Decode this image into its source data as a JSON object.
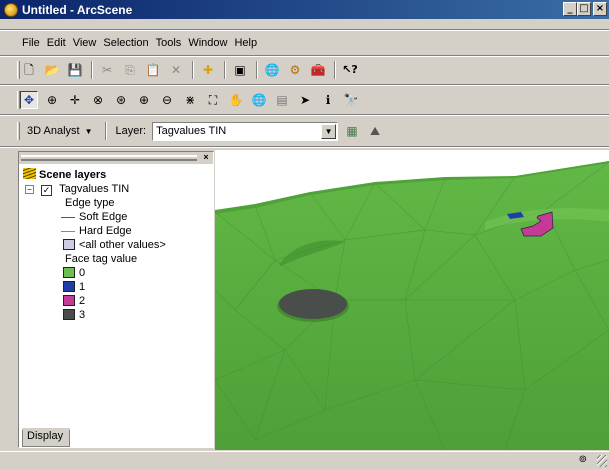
{
  "window": {
    "title": "Untitled - ArcScene",
    "min_glyph": "_",
    "max_glyph": "□",
    "close_glyph": "×"
  },
  "menu": [
    "File",
    "Edit",
    "View",
    "Selection",
    "Tools",
    "Window",
    "Help"
  ],
  "standard_toolbar": [
    {
      "icon": "new-icon",
      "glyph": "🗋"
    },
    {
      "icon": "open-icon",
      "glyph": "📂"
    },
    {
      "icon": "save-icon",
      "glyph": "💾"
    },
    {
      "icon": "cut-icon",
      "glyph": "✂"
    },
    {
      "icon": "copy-icon",
      "glyph": "⎘"
    },
    {
      "icon": "paste-icon",
      "glyph": "📋"
    },
    {
      "icon": "delete-icon",
      "glyph": "✕"
    },
    {
      "icon": "add-data-icon",
      "glyph": "✚"
    },
    {
      "icon": "scene-properties-icon",
      "glyph": "▣"
    },
    {
      "icon": "arctoolbox-icon",
      "glyph": "🌐"
    },
    {
      "icon": "model-builder-icon",
      "glyph": "⚙"
    },
    {
      "icon": "toolbox-icon",
      "glyph": "🧰"
    },
    {
      "icon": "whats-this-icon",
      "glyph": "↖?"
    }
  ],
  "navigation_toolbar": [
    {
      "icon": "navigate-icon",
      "glyph": "✥"
    },
    {
      "icon": "zoom-in-out-icon",
      "glyph": "⊕"
    },
    {
      "icon": "pan-icon",
      "glyph": "✛"
    },
    {
      "icon": "center-on-target-icon",
      "glyph": "⊗"
    },
    {
      "icon": "zoom-to-target-icon",
      "glyph": "⊛"
    },
    {
      "icon": "zoom-in-icon",
      "glyph": "⊕"
    },
    {
      "icon": "zoom-out-icon",
      "glyph": "⊖"
    },
    {
      "icon": "narrow-fov-icon",
      "glyph": "⋇"
    },
    {
      "icon": "full-extent-icon",
      "glyph": "⛶"
    },
    {
      "icon": "hand-icon",
      "glyph": "✋"
    },
    {
      "icon": "globe-icon",
      "glyph": "🌐"
    },
    {
      "icon": "layers-icon",
      "glyph": "▤"
    },
    {
      "icon": "select-pointer-icon",
      "glyph": "➤"
    },
    {
      "icon": "identify-icon",
      "glyph": "ℹ"
    },
    {
      "icon": "find-icon",
      "glyph": "🔭"
    }
  ],
  "analyst_toolbar": {
    "menu_label": "3D Analyst",
    "layer_label": "Layer:",
    "layer_value": "Tagvalues TIN",
    "tools": [
      {
        "icon": "interpolate-icon",
        "glyph": "▦"
      },
      {
        "icon": "steepest-path-icon",
        "glyph": "⛰"
      }
    ]
  },
  "toc": {
    "close_glyph": "×",
    "root_label": "Scene layers",
    "layer": {
      "expand_glyph": "−",
      "checkbox_glyph": "✓",
      "name": "Tagvalues TIN",
      "checked": true
    },
    "edge_heading": "Edge type",
    "edges": [
      {
        "label": "Soft Edge",
        "color": "#555555"
      },
      {
        "label": "Hard Edge",
        "color": "#55aa55"
      }
    ],
    "other_values": {
      "label": "<all other values>",
      "color": "#cccce6"
    },
    "face_heading": "Face tag value",
    "faces": [
      {
        "label": "0",
        "color": "#6dbd4f"
      },
      {
        "label": "1",
        "color": "#1e3fa6"
      },
      {
        "label": "2",
        "color": "#c53a96"
      },
      {
        "label": "3",
        "color": "#4a4e4a"
      }
    ],
    "tab_label": "Display"
  },
  "scene": {
    "background_color": "#ffffff",
    "terrain_color": "#55ad3a",
    "pit_color": "#4a4e4a",
    "building_magenta": "#c53a96",
    "building_blue": "#1e3fa6"
  },
  "status": {
    "icon": "nav-status-icon",
    "glyph": "⊚"
  }
}
